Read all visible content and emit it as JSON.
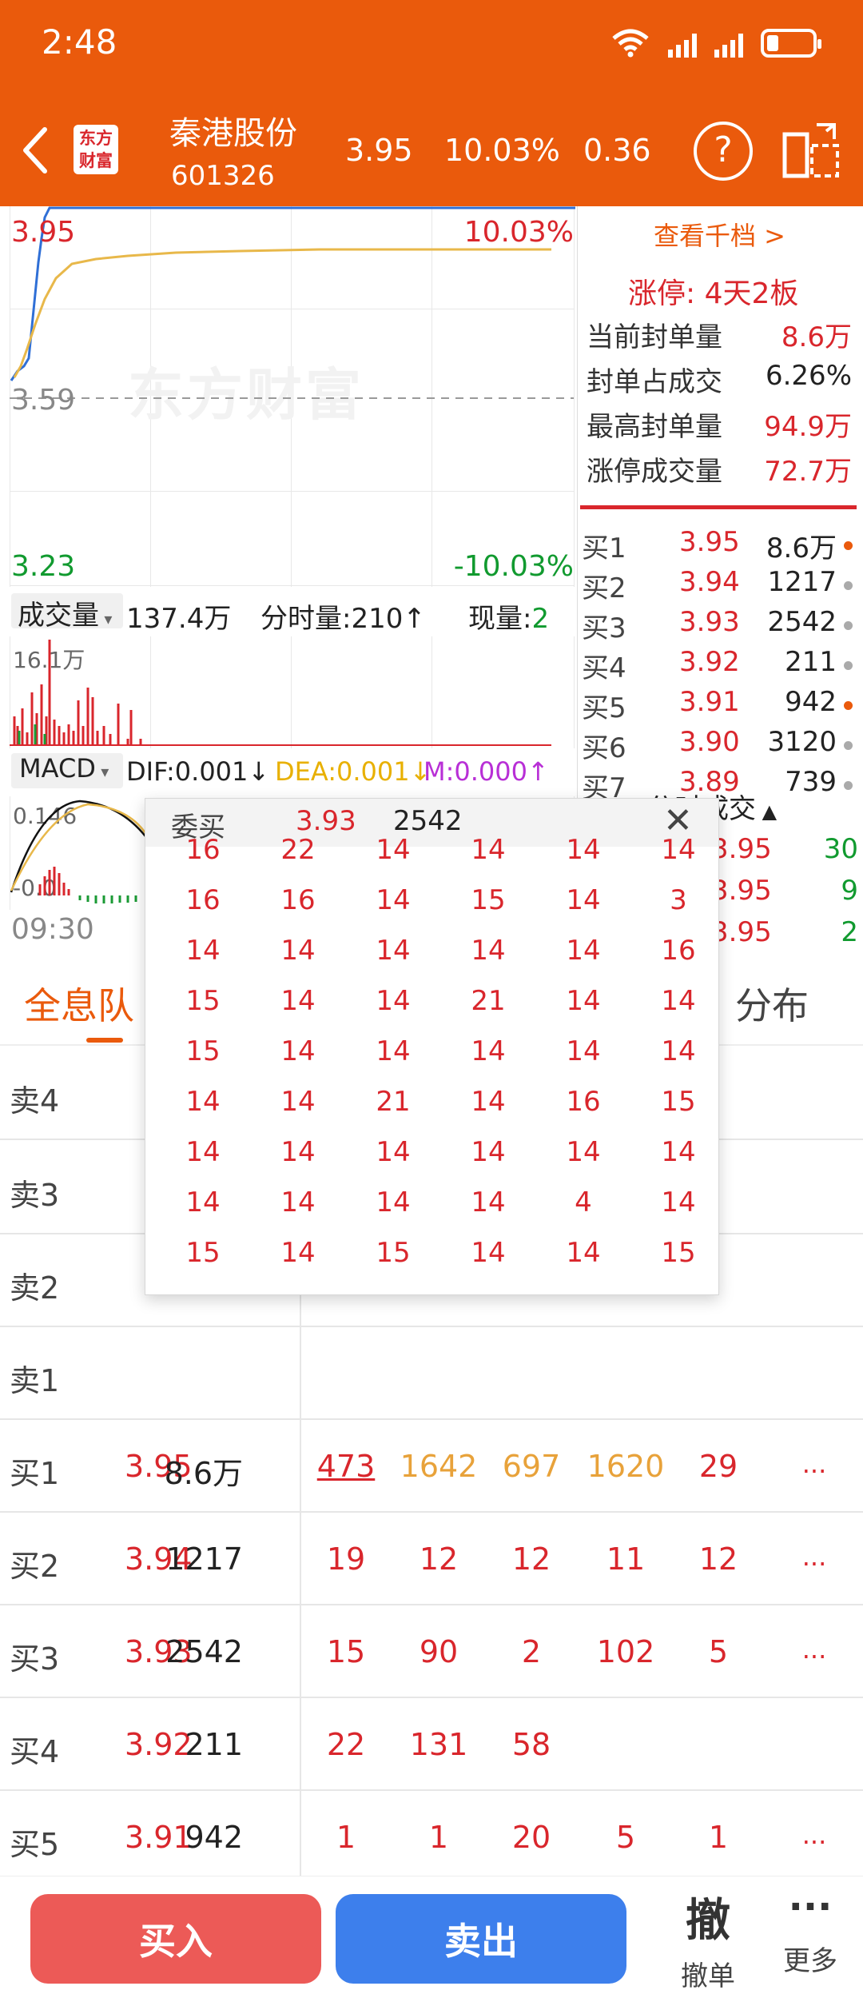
{
  "status_bar": {
    "time": "2:48"
  },
  "header": {
    "logo_line1": "东方",
    "logo_line2": "财富",
    "stock_name": "秦港股份",
    "stock_code": "601326",
    "price": "3.95",
    "change_pct": "10.03%",
    "change": "0.36",
    "help": "?"
  },
  "chart": {
    "high_price": "3.95",
    "high_pct": "10.03%",
    "mid_price": "3.59",
    "low_price": "3.23",
    "low_pct": "-10.03%",
    "watermark": "东方财富",
    "time_start": "09:30"
  },
  "volume_bar": {
    "selector": "成交量",
    "total": "137.4万",
    "period_label": "分时量:210",
    "period_arrow": "↑",
    "now_label": "现量:",
    "now_value": "2",
    "axis_max": "16.1万"
  },
  "macd_bar": {
    "selector": "MACD",
    "dif": "DIF:0.001",
    "dif_arrow": "↓",
    "dea": "DEA:0.001",
    "dea_arrow": "↓",
    "m": "M:0.000",
    "m_arrow": "↑",
    "axis_top": "0.146",
    "axis_mid": "-0.0"
  },
  "right_panel": {
    "link": "查看千档 >",
    "limit_status": "涨停:  4天2板",
    "stats": [
      {
        "label": "当前封单量",
        "value": "8.6万"
      },
      {
        "label": "封单占成交",
        "value": "6.26%"
      },
      {
        "label": "最高封单量",
        "value": "94.9万"
      },
      {
        "label": "涨停成交量",
        "value": "72.7万"
      }
    ],
    "order_book": [
      {
        "label": "买1",
        "price": "3.95",
        "vol": "8.6万"
      },
      {
        "label": "买2",
        "price": "3.94",
        "vol": "1217"
      },
      {
        "label": "买3",
        "price": "3.93",
        "vol": "2542"
      },
      {
        "label": "买4",
        "price": "3.92",
        "vol": "211"
      },
      {
        "label": "买5",
        "price": "3.91",
        "vol": "942"
      },
      {
        "label": "买6",
        "price": "3.90",
        "vol": "3120"
      },
      {
        "label": "买7",
        "price": "3.89",
        "vol": "739"
      }
    ],
    "ticks_title": "分时成交",
    "ticks": [
      {
        "price": "3.95",
        "vol": "30"
      },
      {
        "price": "3.95",
        "vol": "9"
      },
      {
        "price": "3.95",
        "vol": "2"
      }
    ]
  },
  "tabs": {
    "left": "全息队",
    "right": "分布"
  },
  "popup": {
    "title": "委买",
    "price": "3.93",
    "volume": "2542",
    "close": "✕",
    "rows": [
      [
        "16",
        "22",
        "14",
        "14",
        "14",
        "14"
      ],
      [
        "16",
        "16",
        "14",
        "15",
        "14",
        "3"
      ],
      [
        "14",
        "14",
        "14",
        "14",
        "14",
        "16"
      ],
      [
        "15",
        "14",
        "14",
        "21",
        "14",
        "14"
      ],
      [
        "15",
        "14",
        "14",
        "14",
        "14",
        "14"
      ],
      [
        "14",
        "14",
        "21",
        "14",
        "16",
        "15"
      ],
      [
        "14",
        "14",
        "14",
        "14",
        "14",
        "14"
      ],
      [
        "14",
        "14",
        "14",
        "14",
        "4",
        "14"
      ],
      [
        "15",
        "14",
        "15",
        "14",
        "14",
        "15"
      ]
    ]
  },
  "queue_table": {
    "sell_rows": [
      {
        "label": "卖4"
      },
      {
        "label": "卖3"
      },
      {
        "label": "卖2"
      },
      {
        "label": "卖1"
      }
    ],
    "buy_rows": [
      {
        "label": "买1",
        "price": "3.95",
        "vol": "8.6万",
        "q": [
          "473",
          "1642",
          "697",
          "1620",
          "29"
        ],
        "more": "..."
      },
      {
        "label": "买2",
        "price": "3.94",
        "vol": "1217",
        "q": [
          "19",
          "12",
          "12",
          "11",
          "12"
        ],
        "more": "..."
      },
      {
        "label": "买3",
        "price": "3.93",
        "vol": "2542",
        "q": [
          "15",
          "90",
          "2",
          "102",
          "5"
        ],
        "more": "..."
      },
      {
        "label": "买4",
        "price": "3.92",
        "vol": "211",
        "q": [
          "22",
          "131",
          "58"
        ],
        "more": ""
      },
      {
        "label": "买5",
        "price": "3.91",
        "vol": "942",
        "q": [
          "1",
          "1",
          "20",
          "5",
          "1"
        ],
        "more": "..."
      }
    ]
  },
  "bottom": {
    "buy": "买入",
    "sell": "卖出",
    "cancel_icon": "撤",
    "cancel": "撤单",
    "more_icon": "···",
    "more": "更多"
  }
}
